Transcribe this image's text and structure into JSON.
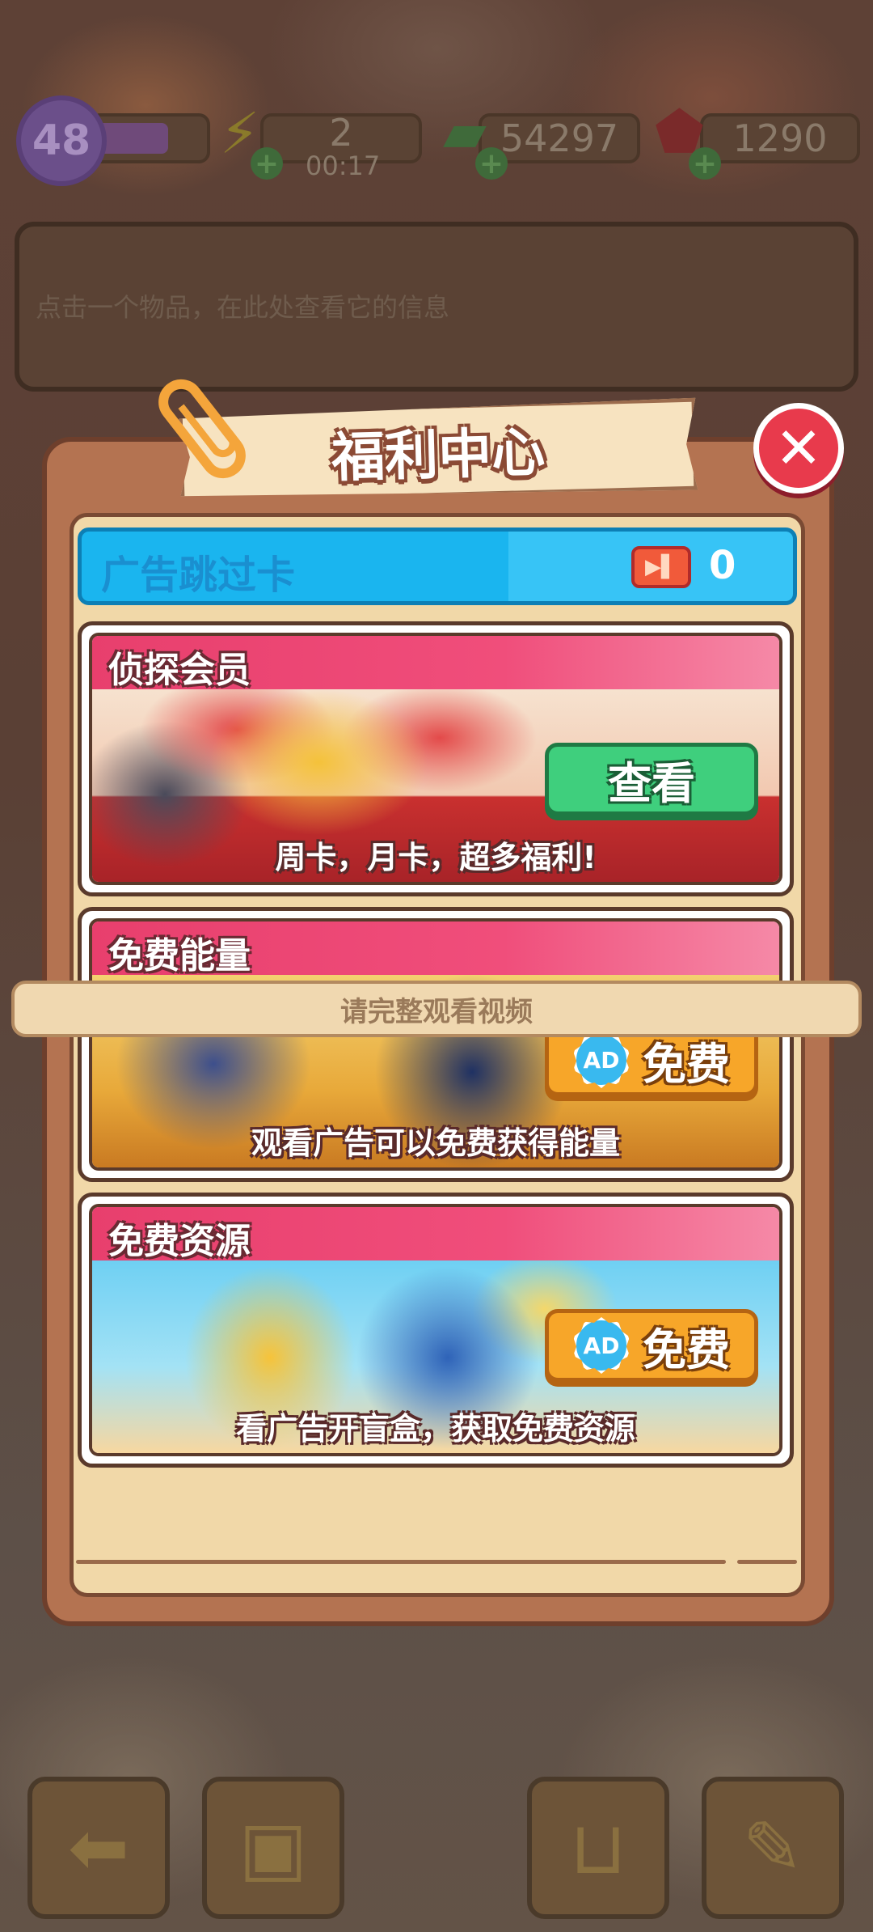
{
  "hud": {
    "level": "48",
    "energy": "2",
    "energy_timer": "00:17",
    "cash": "54297",
    "gems": "1290"
  },
  "info_panel": {
    "text": "点击一个物品，在此处查看它的信息"
  },
  "modal": {
    "title": "福利中心",
    "skip_card": {
      "label": "广告跳过卡",
      "count": "0"
    },
    "cards": [
      {
        "title": "侦探会员",
        "description": "周卡，月卡，超多福利!",
        "button_label": "查看",
        "button_color": "#3fcf7d"
      },
      {
        "title": "免费能量",
        "description": "观看广告可以免费获得能量",
        "button_label": "免费",
        "button_badge": "AD",
        "button_color": "#f7a629"
      },
      {
        "title": "免费资源",
        "description": "看广告开盲盒，获取免费资源",
        "button_label": "免费",
        "button_badge": "AD",
        "button_color": "#f7a629"
      }
    ]
  },
  "toast": {
    "text": "请完整观看视频"
  },
  "toolbar": {
    "items": [
      {
        "icon": "back-arrow-icon"
      },
      {
        "icon": "backpack-icon"
      },
      {
        "icon": "shop-basket-icon"
      },
      {
        "icon": "clipboard-icon"
      }
    ]
  }
}
